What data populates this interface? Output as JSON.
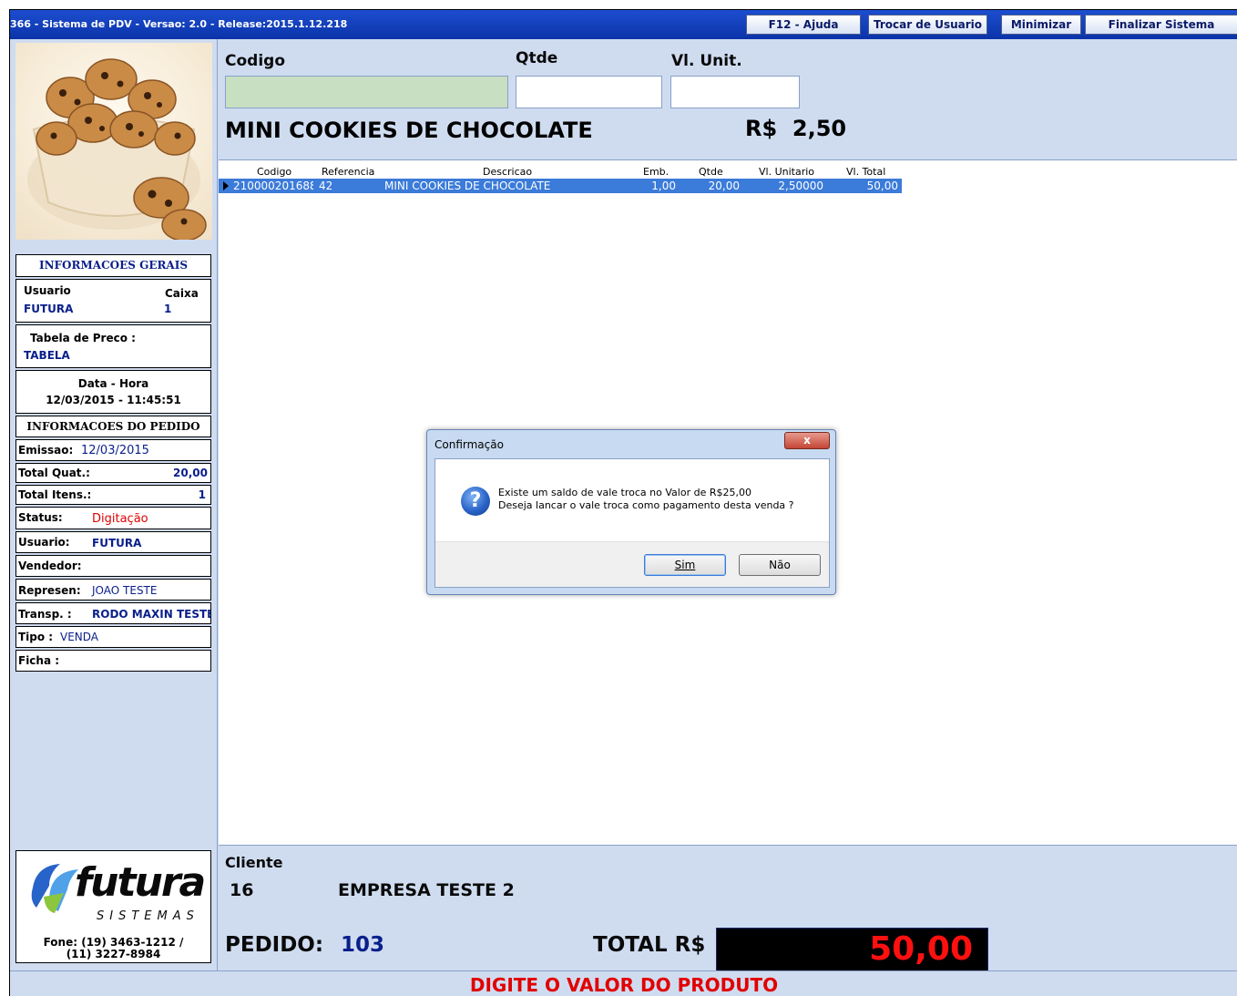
{
  "window": {
    "title": "366 - Sistema de PDV - Versao: 2.0 - Release:2015.1.12.218",
    "buttons": {
      "help": "F12 - Ajuda",
      "switch_user": "Trocar de Usuario",
      "minimize": "Minimizar",
      "exit": "Finalizar Sistema"
    }
  },
  "info_gerais": {
    "header": "INFORMACOES GERAIS",
    "usuario_label": "Usuario",
    "usuario_value": "FUTURA",
    "caixa_label": "Caixa",
    "caixa_value": "1",
    "tabela_label": "Tabela de Preco :",
    "tabela_value": "TABELA",
    "datahora_label": "Data - Hora",
    "datahora_value": "12/03/2015 - 11:45:51"
  },
  "info_pedido": {
    "header": "INFORMACOES DO PEDIDO",
    "emissao_label": "Emissao:",
    "emissao_value": "12/03/2015",
    "total_quat_label": "Total Quat.:",
    "total_quat_value": "20,00",
    "total_itens_label": "Total Itens.:",
    "total_itens_value": "1",
    "status_label": "Status:",
    "status_value": "Digitação",
    "usuario_label": "Usuario:",
    "usuario_value": "FUTURA",
    "vendedor_label": "Vendedor:",
    "vendedor_value": "",
    "represen_label": "Represen:",
    "represen_value": "JOAO TESTE",
    "transp_label": "Transp. :",
    "transp_value": "RODO MAXIN TESTE",
    "tipo_label": "Tipo :",
    "tipo_value": "VENDA",
    "ficha_label": "Ficha :",
    "ficha_value": ""
  },
  "logo": {
    "brand": "futura",
    "tagline": "SISTEMAS",
    "phone1": "Fone: (19) 3463-1212 /",
    "phone2": "(11) 3227-8984"
  },
  "input_area": {
    "codigo_label": "Codigo",
    "qtde_label": "Qtde",
    "vlunit_label": "Vl. Unit.",
    "codigo_value": "",
    "qtde_value": "",
    "vlunit_value": "",
    "product_name": "MINI COOKIES DE CHOCOLATE",
    "price": "R$  2,50"
  },
  "grid": {
    "headers": [
      "Codigo",
      "Referencia",
      "Descricao",
      "Emb.",
      "Qtde",
      "Vl. Unitario",
      "Vl. Total"
    ],
    "rows": [
      [
        "210000201688",
        "42",
        "MINI COOKIES DE CHOCOLATE",
        "1,00",
        "20,00",
        "2,50000",
        "50,00"
      ]
    ]
  },
  "cliente": {
    "label": "Cliente",
    "code": "16",
    "name": "EMPRESA TESTE 2"
  },
  "pedido": {
    "label": "PEDIDO:",
    "number": "103",
    "total_label": "TOTAL R$",
    "total_value": "50,00"
  },
  "status_message": "DIGITE O VALOR DO PRODUTO",
  "dialog": {
    "title": "Confirmação",
    "line1": "Existe um saldo de vale troca no Valor de R$25,00",
    "line2": "Deseja lancar o vale troca como pagamento desta venda ?",
    "yes": "Sim",
    "no": "Não",
    "close_glyph": "x"
  },
  "colors": {
    "accent": "#1d4ed0",
    "status_red": "#e10000",
    "navy_value": "#0a1f8a",
    "row_highlight": "#3b7bd9"
  }
}
